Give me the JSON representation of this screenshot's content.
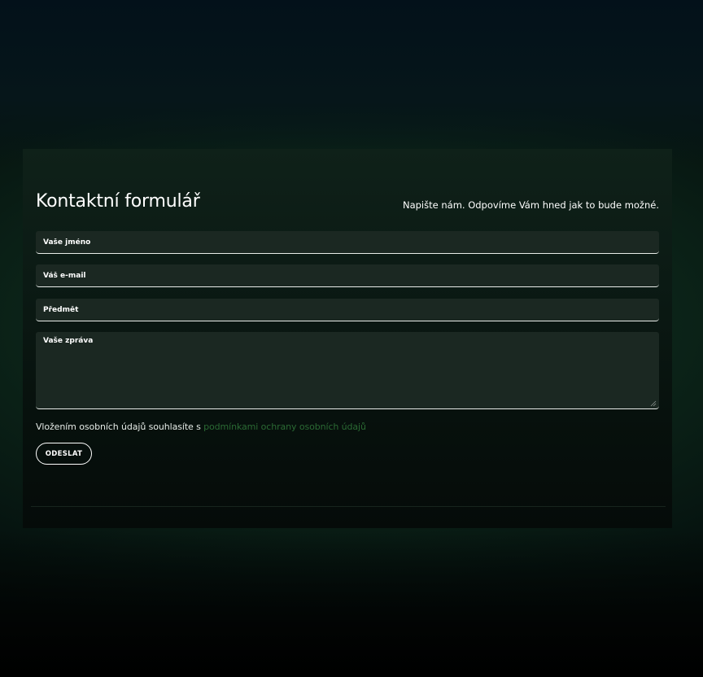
{
  "form": {
    "title": "Kontaktní formulář",
    "subtitle": "Napište nám. Odpovíme Vám hned jak to bude možné.",
    "fields": {
      "name_placeholder": "Vaše jméno",
      "email_placeholder": "Váš e-mail",
      "subject_placeholder": "Předmět",
      "message_placeholder": "Vaše zpráva"
    },
    "consent": {
      "text": "Vložením osobních údajů souhlasíte s ",
      "link_text": "podmínkami ochrany osobních údajů"
    },
    "submit_label": "ODESLAT"
  },
  "colors": {
    "accent_link": "#2b6a34",
    "field_background": "#1b2822",
    "text": "#ffffff"
  }
}
